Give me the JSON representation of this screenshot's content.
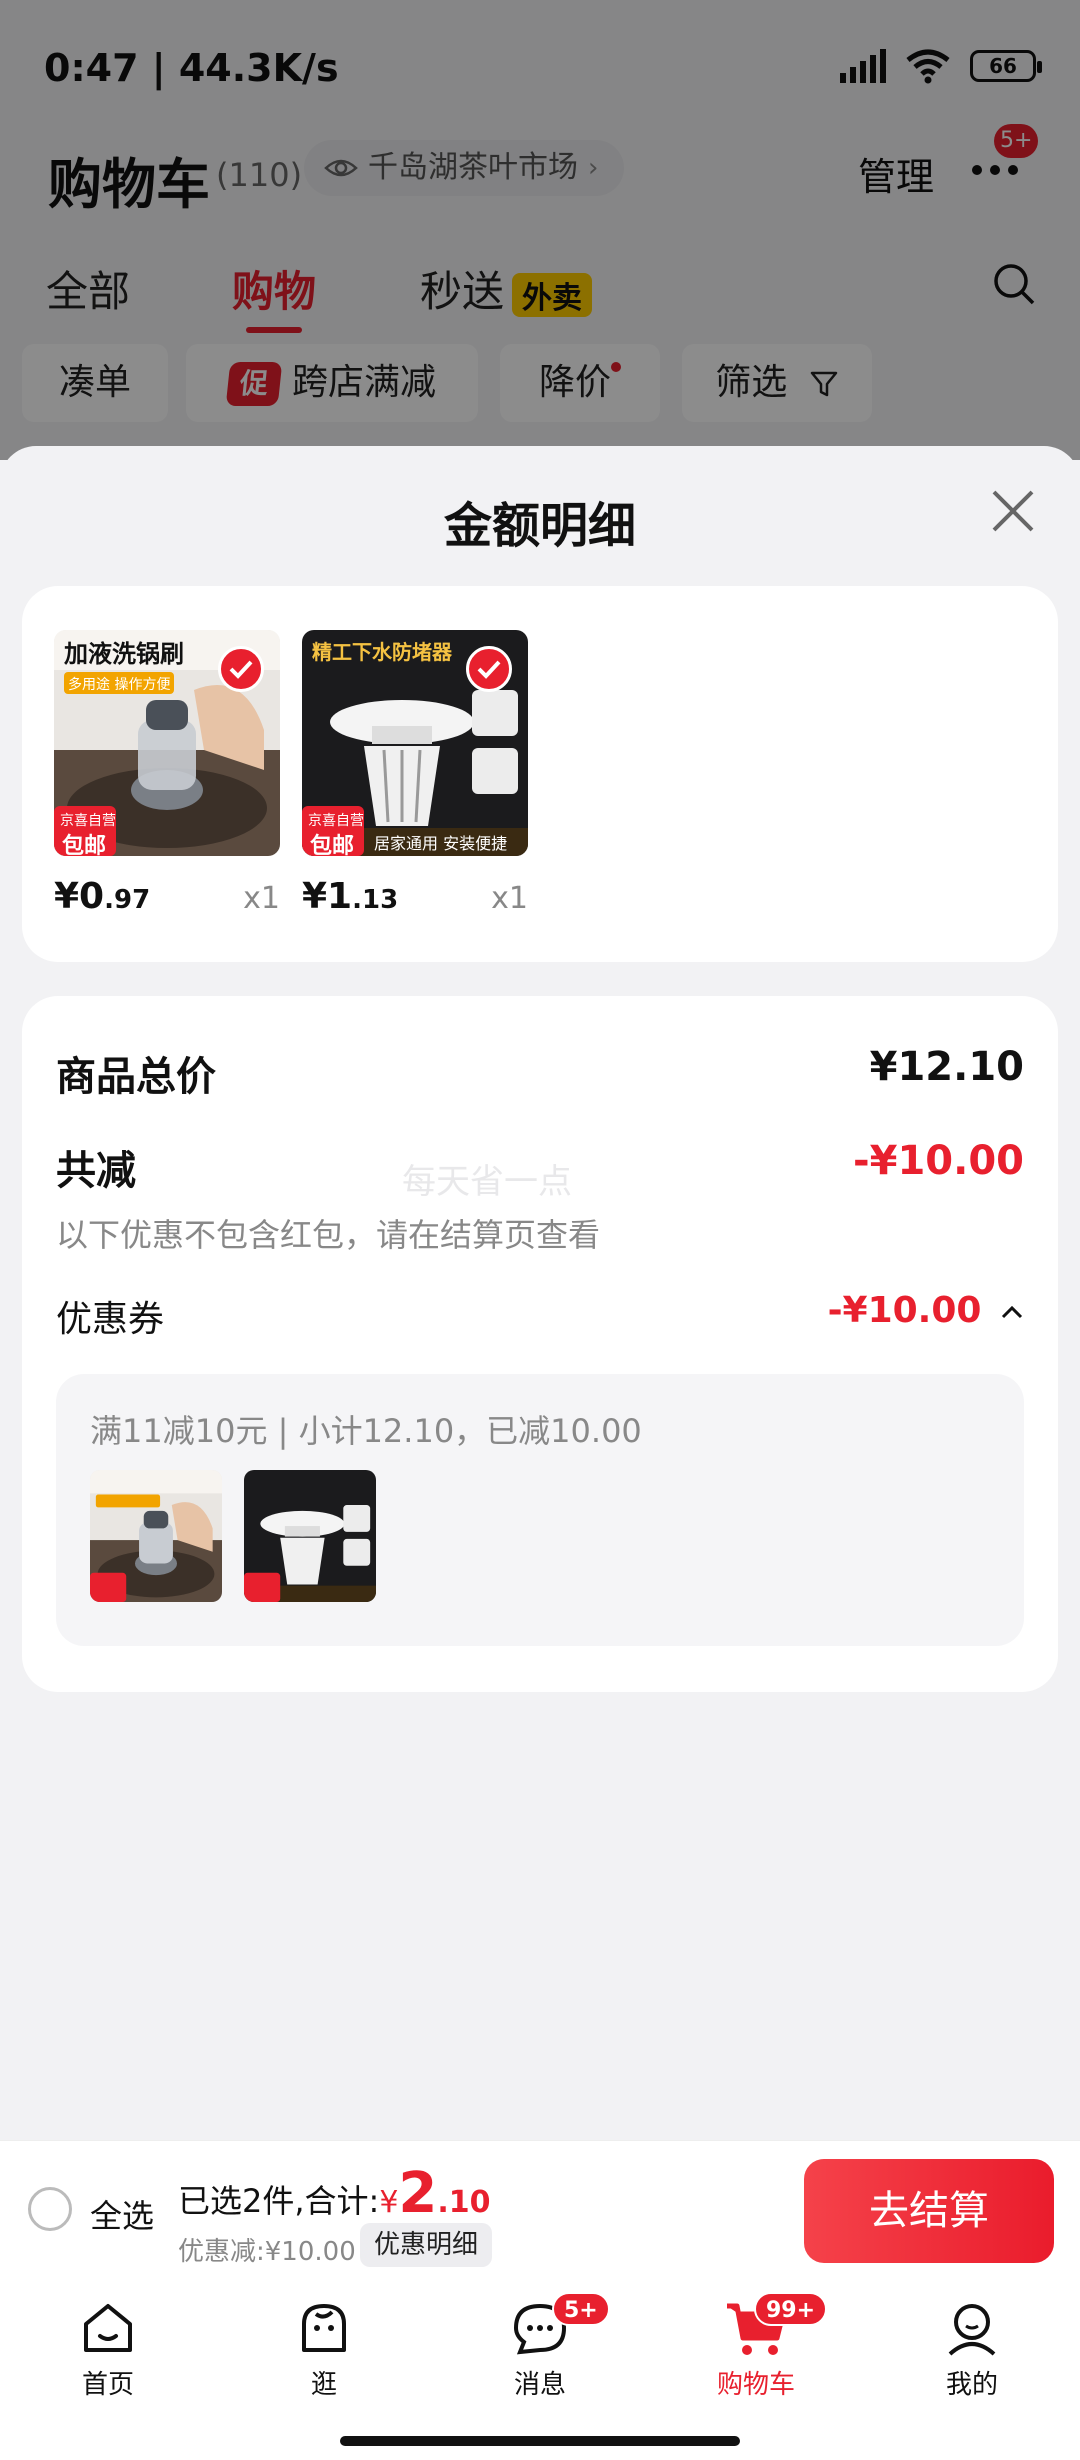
{
  "status_bar": {
    "time": "0:47 | 44.3K/s",
    "battery": "66"
  },
  "header": {
    "title": "购物车",
    "count": "(110)",
    "location": "千岛湖茶叶市场",
    "manage": "管理",
    "more_badge": "5+"
  },
  "tabs": [
    {
      "label": "全部"
    },
    {
      "label": "购物"
    },
    {
      "label": "秒送",
      "tag": "外卖"
    }
  ],
  "chips": [
    {
      "label": "凑单"
    },
    {
      "label": "跨店满减",
      "icon_text": "促"
    },
    {
      "label": "降价"
    },
    {
      "label": "筛选"
    }
  ],
  "sheet": {
    "title": "金额明细",
    "products": [
      {
        "name": "加液洗锅刷",
        "banner": "多用途 操作方便",
        "badge_top": "京喜自营",
        "badge_bottom": "包邮",
        "price_int": "¥0",
        "price_dec": ".97",
        "qty": "x1"
      },
      {
        "name": "精工下水防堵器",
        "banner": "居家通用 安装便捷",
        "badge_top": "京喜自营",
        "badge_bottom": "包邮",
        "price_int": "¥1",
        "price_dec": ".13",
        "qty": "x1"
      }
    ],
    "total_label": "商品总价",
    "total_value": "¥12.10",
    "reduce_label": "共减",
    "reduce_value": "-¥10.00",
    "reduce_note": "以下优惠不包含红包，请在结算页查看",
    "watermark": "每天省一点",
    "coupon_label": "优惠券",
    "coupon_value": "-¥10.00",
    "coupon_detail": "满11减10元 | 小计12.10，已减10.00"
  },
  "checkout": {
    "select_all": "全选",
    "selected_text": "已选2件,合计:",
    "currency": "¥",
    "total_int": "2",
    "total_dec": ".10",
    "discount_text": "优惠减:¥10.00",
    "discount_button": "优惠明细",
    "pay_button": "去结算"
  },
  "tabbar": [
    {
      "label": "首页"
    },
    {
      "label": "逛"
    },
    {
      "label": "消息",
      "badge": "5+"
    },
    {
      "label": "购物车",
      "badge": "99+"
    },
    {
      "label": "我的"
    }
  ],
  "colors": {
    "accent": "#e8202e",
    "background": "#f2f2f4",
    "card": "#ffffff"
  }
}
